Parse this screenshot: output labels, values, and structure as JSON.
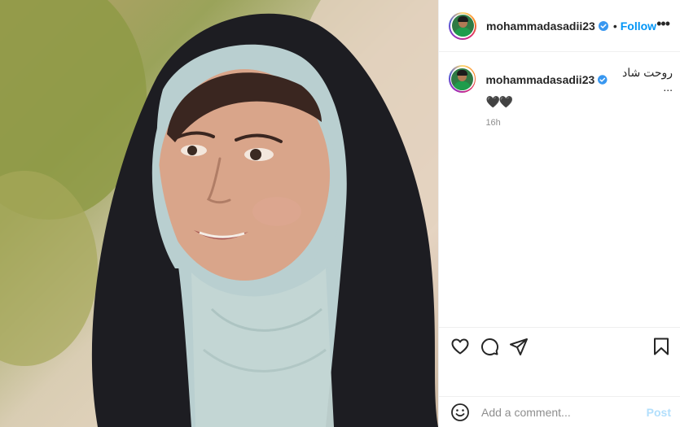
{
  "post": {
    "image_alt": "Woman wearing a black chador over a light blue headscarf, smiling",
    "username": "mohammadasadii23",
    "follow_label": "Follow",
    "dot": "•",
    "more_label": "•••",
    "caption_text": "روحت شاد ...",
    "caption_hearts": "🖤🖤",
    "time_ago": "16h"
  },
  "comment": {
    "placeholder": "Add a comment...",
    "post_label": "Post"
  },
  "colors": {
    "accent": "#0095f6",
    "post_disabled": "#b2dffc",
    "muted": "#8e8e8e",
    "border": "#efefef"
  },
  "icons": {
    "like": "heart-icon",
    "comment": "comment-icon",
    "share": "share-icon",
    "save": "bookmark-icon",
    "emoji": "emoji-icon",
    "verified": "verified-badge-icon"
  }
}
